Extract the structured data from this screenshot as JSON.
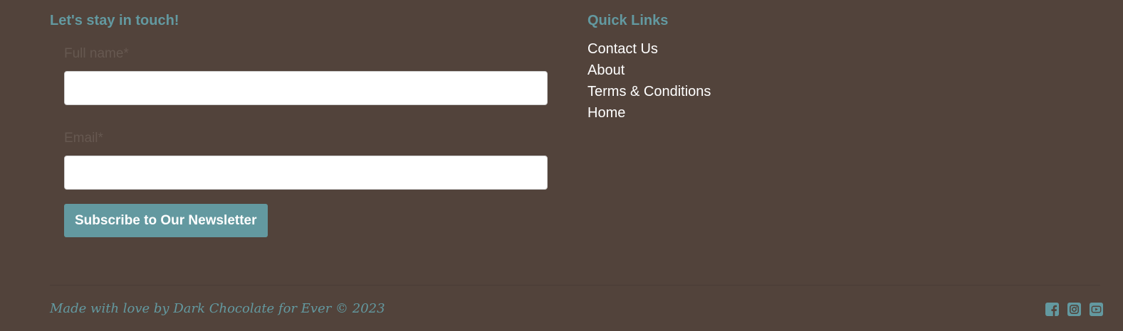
{
  "newsletter": {
    "heading": "Let's stay in touch!",
    "name_label": "Full name*",
    "name_value": "",
    "email_label": "Email*",
    "email_value": "",
    "subscribe_label": "Subscribe to Our Newsletter"
  },
  "quick_links": {
    "heading": "Quick Links",
    "items": [
      {
        "label": "Contact Us"
      },
      {
        "label": "About"
      },
      {
        "label": "Terms & Conditions"
      },
      {
        "label": "Home"
      }
    ]
  },
  "footer": {
    "credit": "Made with love by Dark Chocolate for Ever © 2023",
    "socials": [
      {
        "icon": "facebook-icon"
      },
      {
        "icon": "instagram-icon"
      },
      {
        "icon": "youtube-icon"
      }
    ]
  },
  "colors": {
    "background": "#52433b",
    "accent": "#6399a0",
    "link_text": "#ffffff",
    "label_text": "#665850"
  }
}
